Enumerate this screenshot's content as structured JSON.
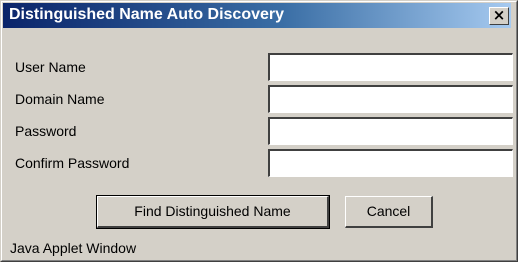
{
  "window": {
    "title": "Distinguished Name Auto Discovery",
    "close_icon": "close-icon",
    "close_glyph": "×"
  },
  "form": {
    "fields": [
      {
        "label": "User Name",
        "value": "",
        "placeholder": ""
      },
      {
        "label": "Domain Name",
        "value": "",
        "placeholder": ""
      },
      {
        "label": "Password",
        "value": "",
        "placeholder": ""
      },
      {
        "label": "Confirm Password",
        "value": "",
        "placeholder": ""
      }
    ]
  },
  "buttons": {
    "find_label": "Find Distinguished Name",
    "cancel_label": "Cancel"
  },
  "status": {
    "text": "Java Applet Window"
  },
  "colors": {
    "titlebar_start": "#0a246a",
    "titlebar_end": "#a6caf0",
    "window_bg": "#d4d0c8"
  }
}
